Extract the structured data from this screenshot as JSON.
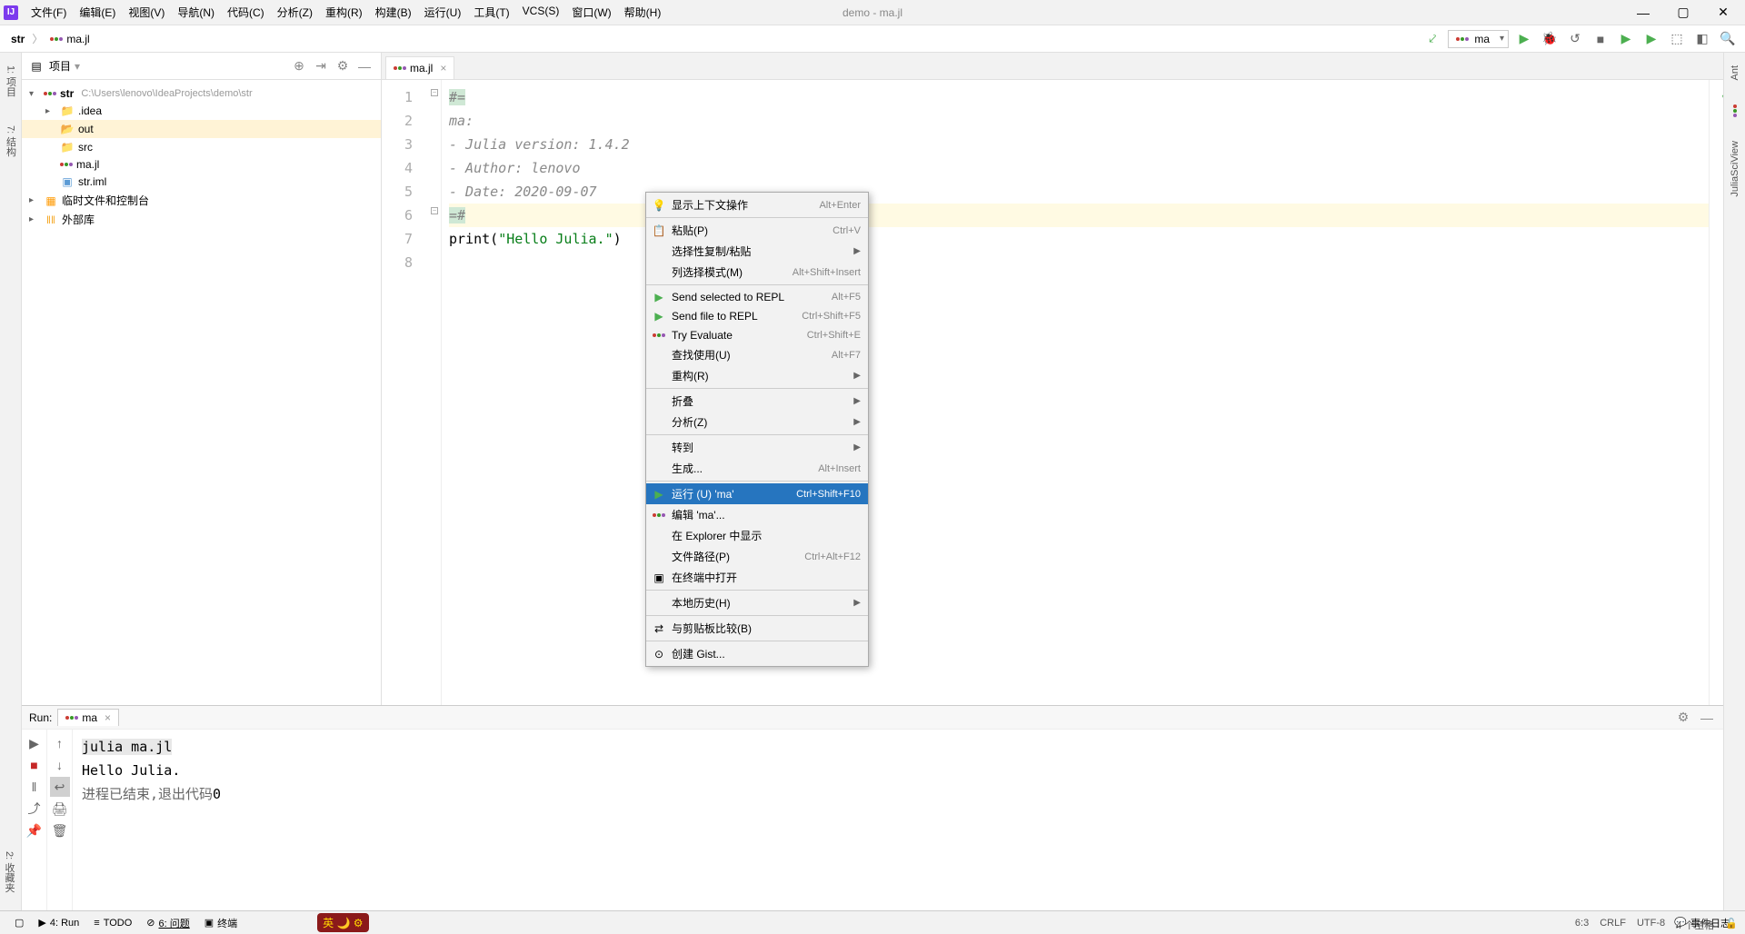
{
  "window_title": "demo - ma.jl",
  "menu": [
    "文件(F)",
    "编辑(E)",
    "视图(V)",
    "导航(N)",
    "代码(C)",
    "分析(Z)",
    "重构(R)",
    "构建(B)",
    "运行(U)",
    "工具(T)",
    "VCS(S)",
    "窗口(W)",
    "帮助(H)"
  ],
  "breadcrumb": {
    "root": "str",
    "file": "ma.jl"
  },
  "run_config": "ma",
  "project": {
    "panel_title": "项目",
    "root": {
      "name": "str",
      "path": "C:\\Users\\lenovo\\IdeaProjects\\demo\\str"
    },
    "children": [
      {
        "name": ".idea",
        "type": "folder"
      },
      {
        "name": "out",
        "type": "folder-open"
      },
      {
        "name": "src",
        "type": "folder"
      },
      {
        "name": "ma.jl",
        "type": "julia"
      },
      {
        "name": "str.iml",
        "type": "iml"
      }
    ],
    "extra": [
      {
        "name": "临时文件和控制台",
        "type": "scratch"
      },
      {
        "name": "外部库",
        "type": "lib"
      }
    ]
  },
  "editor": {
    "tab": "ma.jl",
    "lines": [
      "#=",
      "ma:",
      "- Julia version: 1.4.2",
      "- Author: lenovo",
      "- Date: 2020-09-07",
      "=#",
      "print(\"Hello Julia.\")",
      ""
    ]
  },
  "context_menu": [
    {
      "icon": "💡",
      "label": "显示上下文操作",
      "shortcut": "Alt+Enter"
    },
    {
      "sep": true
    },
    {
      "icon": "📋",
      "label": "粘贴(P)",
      "shortcut": "Ctrl+V"
    },
    {
      "label": "选择性复制/粘贴",
      "submenu": true
    },
    {
      "label": "列选择模式(M)",
      "shortcut": "Alt+Shift+Insert"
    },
    {
      "sep": true
    },
    {
      "icon": "▶",
      "icon_color": "#4caf50",
      "label": "Send selected to REPL",
      "shortcut": "Alt+F5"
    },
    {
      "icon": "▶",
      "icon_color": "#4caf50",
      "label": "Send file to REPL",
      "shortcut": "Ctrl+Shift+F5"
    },
    {
      "icon": "julia",
      "label": "Try Evaluate",
      "shortcut": "Ctrl+Shift+E"
    },
    {
      "label": "查找使用(U)",
      "shortcut": "Alt+F7"
    },
    {
      "label": "重构(R)",
      "submenu": true
    },
    {
      "sep": true
    },
    {
      "label": "折叠",
      "submenu": true
    },
    {
      "label": "分析(Z)",
      "submenu": true
    },
    {
      "sep": true
    },
    {
      "label": "转到",
      "submenu": true
    },
    {
      "label": "生成...",
      "shortcut": "Alt+Insert"
    },
    {
      "sep": true
    },
    {
      "icon": "▶",
      "icon_color": "#4caf50",
      "label": "运行 (U) 'ma'",
      "shortcut": "Ctrl+Shift+F10",
      "highlighted": true
    },
    {
      "icon": "julia",
      "label": "编辑 'ma'..."
    },
    {
      "label": "在 Explorer 中显示"
    },
    {
      "label": "文件路径(P)",
      "shortcut": "Ctrl+Alt+F12"
    },
    {
      "icon": "▣",
      "label": "在终端中打开"
    },
    {
      "sep": true
    },
    {
      "label": "本地历史(H)",
      "submenu": true
    },
    {
      "sep": true
    },
    {
      "icon": "⇄",
      "label": "与剪贴板比较(B)"
    },
    {
      "sep": true
    },
    {
      "icon": "⊙",
      "label": "创建 Gist..."
    }
  ],
  "run": {
    "title": "Run:",
    "tab": "ma",
    "output": [
      {
        "text": "julia ma.jl",
        "cls": "out-hl"
      },
      {
        "text": "Hello Julia.",
        "cls": ""
      },
      {
        "text": "进程已结束,退出代码",
        "code": "0",
        "cls": "out-proc"
      }
    ]
  },
  "bottom": {
    "items": [
      "4: Run",
      "TODO",
      "6: 问题",
      "终端"
    ],
    "right_label": "事件日志",
    "status": {
      "pos": "6:3",
      "crlf": "CRLF",
      "enc": "UTF-8",
      "indent": "4 个空格"
    }
  },
  "side_tabs": {
    "left": [
      "1: 项目",
      "7: 结构"
    ],
    "right": [
      "Ant",
      "JuliaSciView"
    ],
    "bottom_left": "2: 收藏夹"
  }
}
